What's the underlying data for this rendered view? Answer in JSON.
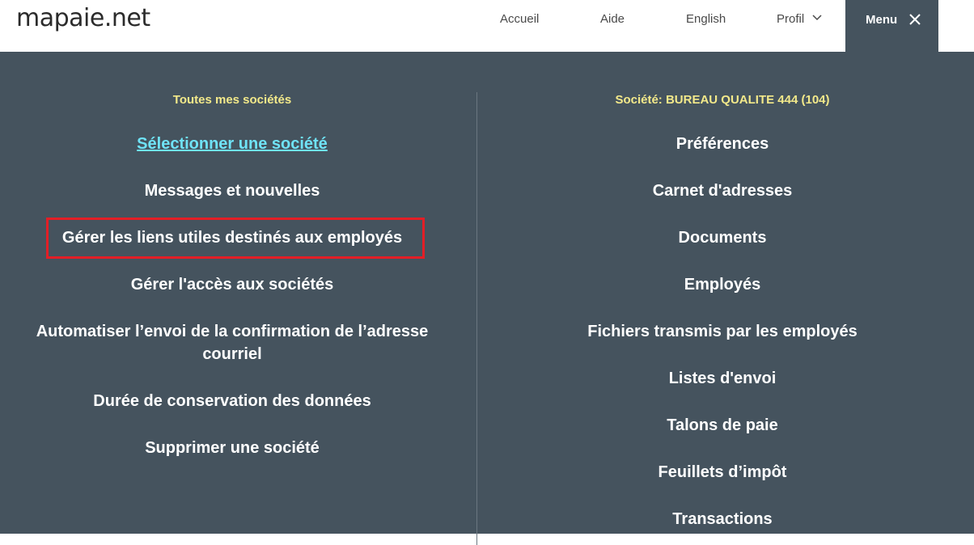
{
  "header": {
    "logo": "mapaie.net",
    "nav": {
      "home": "Accueil",
      "help": "Aide",
      "language": "English",
      "profile": "Profil"
    },
    "menu_label": "Menu"
  },
  "left": {
    "title": "Toutes mes sociétés",
    "items": [
      "Sélectionner une société",
      "Messages et nouvelles",
      "Gérer les liens utiles destinés aux employés",
      "Gérer l'accès aux sociétés",
      "Automatiser l’envoi de la confirmation de l’adresse courriel",
      "Durée de conservation des données",
      "Supprimer une société"
    ]
  },
  "right": {
    "title": "Société: BUREAU QUALITE 444 (104)",
    "items": [
      "Préférences",
      "Carnet d'adresses",
      "Documents",
      "Employés",
      "Fichiers transmis par les employés",
      "Listes d'envoi",
      "Talons de paie",
      "Feuillets d’impôt",
      "Transactions"
    ]
  },
  "colors": {
    "panel_bg": "#45535e",
    "section_title": "#f3e98a",
    "link": "#6fe3f7",
    "highlight": "#e31e26"
  }
}
